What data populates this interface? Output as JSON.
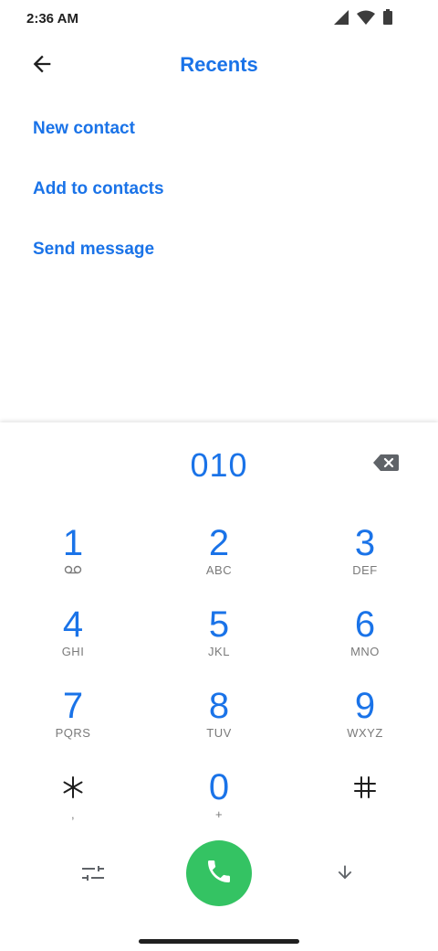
{
  "status_bar": {
    "time": "2:36 AM",
    "icons": [
      "cell-signal-icon",
      "wifi-icon",
      "battery-icon"
    ]
  },
  "app_bar": {
    "title": "Recents",
    "back_icon": "arrow-back-icon"
  },
  "actions": [
    {
      "label": "New contact"
    },
    {
      "label": "Add to contacts"
    },
    {
      "label": "Send message"
    }
  ],
  "dialpad": {
    "digits": "010",
    "backspace_icon": "backspace-icon",
    "keys": [
      {
        "digit": "1",
        "letters": "",
        "icon": "voicemail-icon"
      },
      {
        "digit": "2",
        "letters": "ABC"
      },
      {
        "digit": "3",
        "letters": "DEF"
      },
      {
        "digit": "4",
        "letters": "GHI"
      },
      {
        "digit": "5",
        "letters": "JKL"
      },
      {
        "digit": "6",
        "letters": "MNO"
      },
      {
        "digit": "7",
        "letters": "PQRS"
      },
      {
        "digit": "8",
        "letters": "TUV"
      },
      {
        "digit": "9",
        "letters": "WXYZ"
      },
      {
        "digit": "*",
        "letters": ","
      },
      {
        "digit": "0",
        "letters": "+"
      },
      {
        "digit": "#",
        "letters": ""
      }
    ]
  },
  "bottom_bar": {
    "options_icon": "tune-icon",
    "call_icon": "phone-icon",
    "hide_dialpad_icon": "arrow-down-icon"
  },
  "colors": {
    "accent": "#1a73e8",
    "call_green": "#34c363",
    "secondary_text": "#7a7a7a"
  }
}
